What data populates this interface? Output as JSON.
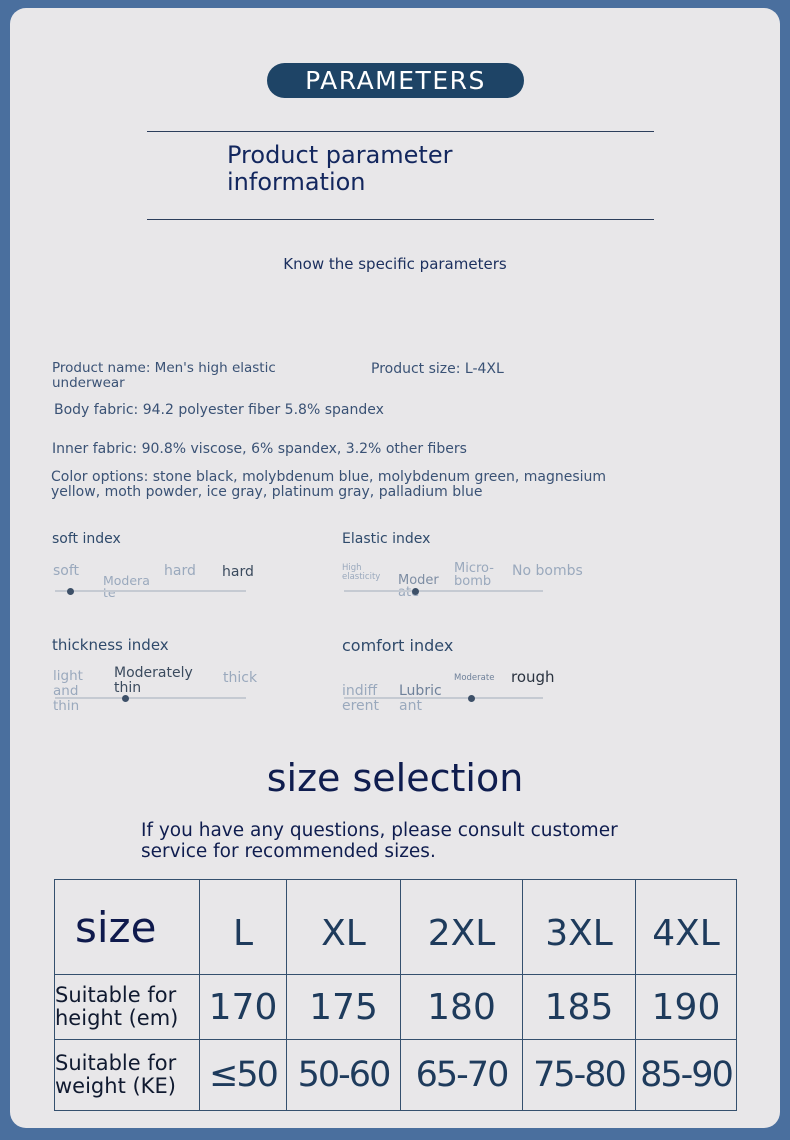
{
  "header": {
    "badge": "PARAMETERS",
    "title_line1": "Product parameter",
    "title_line2": "information",
    "subtitle": "Know the specific parameters"
  },
  "info": {
    "product_name_line1": "Product name: Men's high elastic",
    "product_name_line2": "underwear",
    "product_size": "Product size: L-4XL",
    "body_fabric": "Body fabric: 94.2 polyester fiber 5.8% spandex",
    "inner_fabric": "Inner fabric: 90.8% viscose, 6% spandex, 3.2% other fibers",
    "color_line1": "Color options: stone black, molybdenum blue, molybdenum green, magnesium",
    "color_line2": "yellow, moth powder, ice gray, platinum gray, palladium blue"
  },
  "indexes": {
    "soft": {
      "title": "soft index",
      "labels": [
        "soft",
        "Modera",
        "te",
        "hard",
        "hard"
      ],
      "level": 0.08
    },
    "elastic": {
      "title": "Elastic index",
      "labels": [
        "High",
        "elasticity",
        "Moder",
        "ate",
        "Micro-",
        "bomb",
        "No bombs"
      ],
      "level": 0.36
    },
    "thickness": {
      "title": "thickness index",
      "labels": [
        "light",
        "and",
        "thin",
        "Moderately",
        "thin",
        "thick"
      ],
      "level": 0.37
    },
    "comfort": {
      "title": "comfort index",
      "labels": [
        "indiff",
        "erent",
        "Lubric",
        "ant",
        "Moderate",
        "rough"
      ],
      "level": 0.64
    }
  },
  "size_section": {
    "heading": "size selection",
    "note_line1": "If you have any questions, please consult customer",
    "note_line2": "service for recommended sizes.",
    "table": {
      "size_label": "size",
      "sizes": [
        "L",
        "XL",
        "2XL",
        "3XL",
        "4XL"
      ],
      "height_label_line1": "Suitable for",
      "height_label_line2": "height (em)",
      "heights": [
        "170",
        "175",
        "180",
        "185",
        "190"
      ],
      "weight_label_line1": "Suitable for",
      "weight_label_line2": "weight (KE)",
      "weights": [
        "≤50",
        "50-60",
        "65-70",
        "75-80",
        "85-90"
      ]
    }
  }
}
